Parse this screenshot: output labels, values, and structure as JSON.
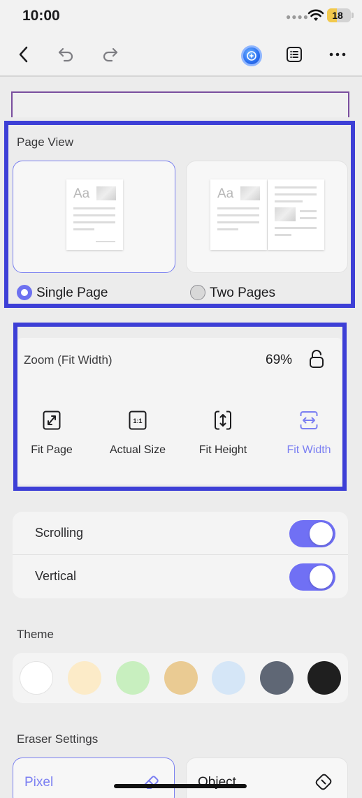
{
  "status_bar": {
    "time": "10:00",
    "battery": "18"
  },
  "toolbar": {
    "back_icon": "chevron-left-icon",
    "undo_icon": "undo-icon",
    "redo_icon": "redo-icon",
    "ai_icon": "ai-assistant-icon",
    "list_icon": "list-icon",
    "more_icon": "more-icon"
  },
  "page_view": {
    "title": "Page View",
    "options": [
      {
        "label": "Single Page",
        "selected": true
      },
      {
        "label": "Two Pages",
        "selected": false
      }
    ],
    "thumb_text": "Aa"
  },
  "zoom": {
    "label": "Zoom (Fit Width)",
    "value": "69%",
    "options": [
      {
        "label": "Fit Page",
        "icon": "fit-page-icon",
        "active": false
      },
      {
        "label": "Actual Size",
        "icon": "actual-size-icon",
        "icon_text": "1:1",
        "active": false
      },
      {
        "label": "Fit Height",
        "icon": "fit-height-icon",
        "active": false
      },
      {
        "label": "Fit Width",
        "icon": "fit-width-icon",
        "active": true
      }
    ]
  },
  "toggles": [
    {
      "label": "Scrolling",
      "on": true
    },
    {
      "label": "Vertical",
      "on": true
    }
  ],
  "theme": {
    "title": "Theme",
    "colors": [
      "#ffffff",
      "#fcebc8",
      "#c8efbf",
      "#eacb93",
      "#d5e6f7",
      "#5f6775",
      "#1f1f1f"
    ]
  },
  "eraser": {
    "title": "Eraser Settings",
    "options": [
      {
        "label": "Pixel",
        "icon": "eraser-icon",
        "selected": true
      },
      {
        "label": "Object",
        "icon": "object-eraser-icon",
        "selected": false
      }
    ]
  },
  "colors": {
    "accent": "#6d71f0",
    "highlight": "#3d3fd6"
  }
}
